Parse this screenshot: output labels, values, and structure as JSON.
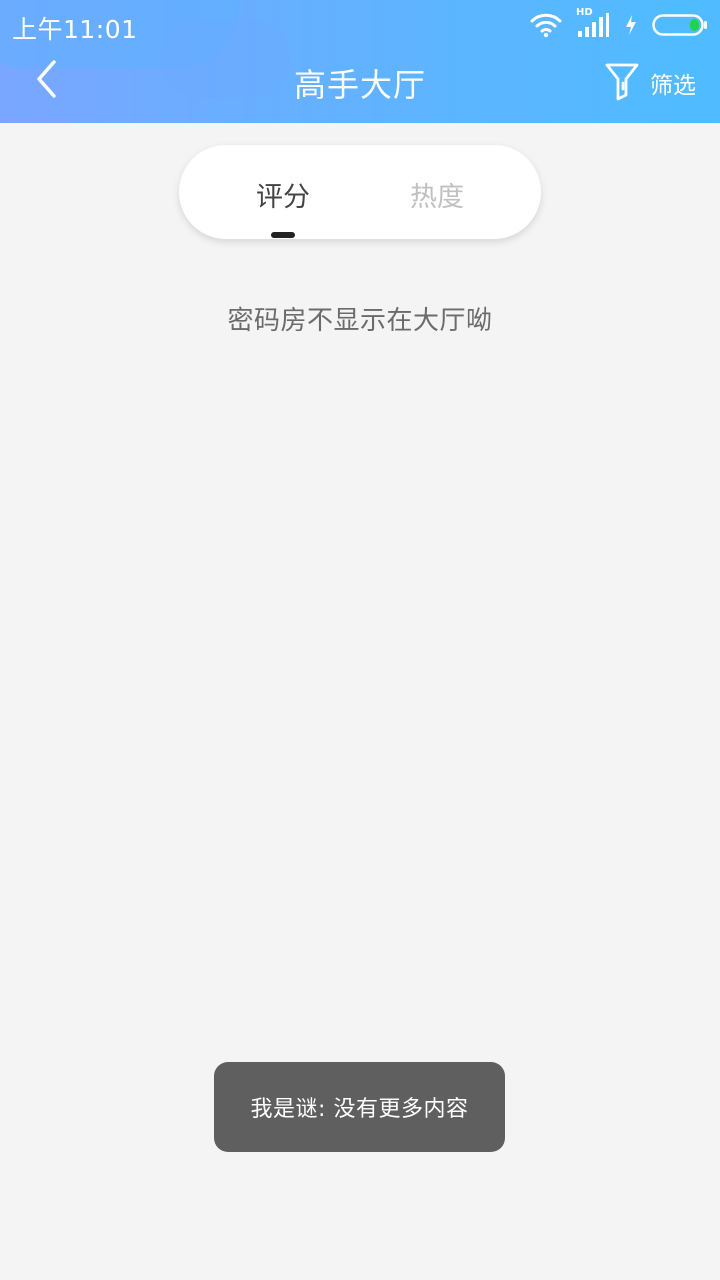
{
  "status_bar": {
    "time": "上午11:01",
    "network_badge": "HD",
    "icons": [
      "wifi-icon",
      "signal-icon",
      "charging-icon",
      "battery-icon"
    ],
    "battery_color": "#22d34a"
  },
  "header": {
    "title": "高手大厅",
    "back_icon": "chevron-left-icon",
    "filter_icon": "filter-icon",
    "filter_label": "筛选",
    "gradient": [
      "#7aa6ff",
      "#4fbcff"
    ]
  },
  "tabs": {
    "items": [
      {
        "label": "评分",
        "active": true
      },
      {
        "label": "热度",
        "active": false
      }
    ]
  },
  "main": {
    "empty_message": "密码房不显示在大厅呦"
  },
  "toast": {
    "message": "我是谜: 没有更多内容"
  }
}
